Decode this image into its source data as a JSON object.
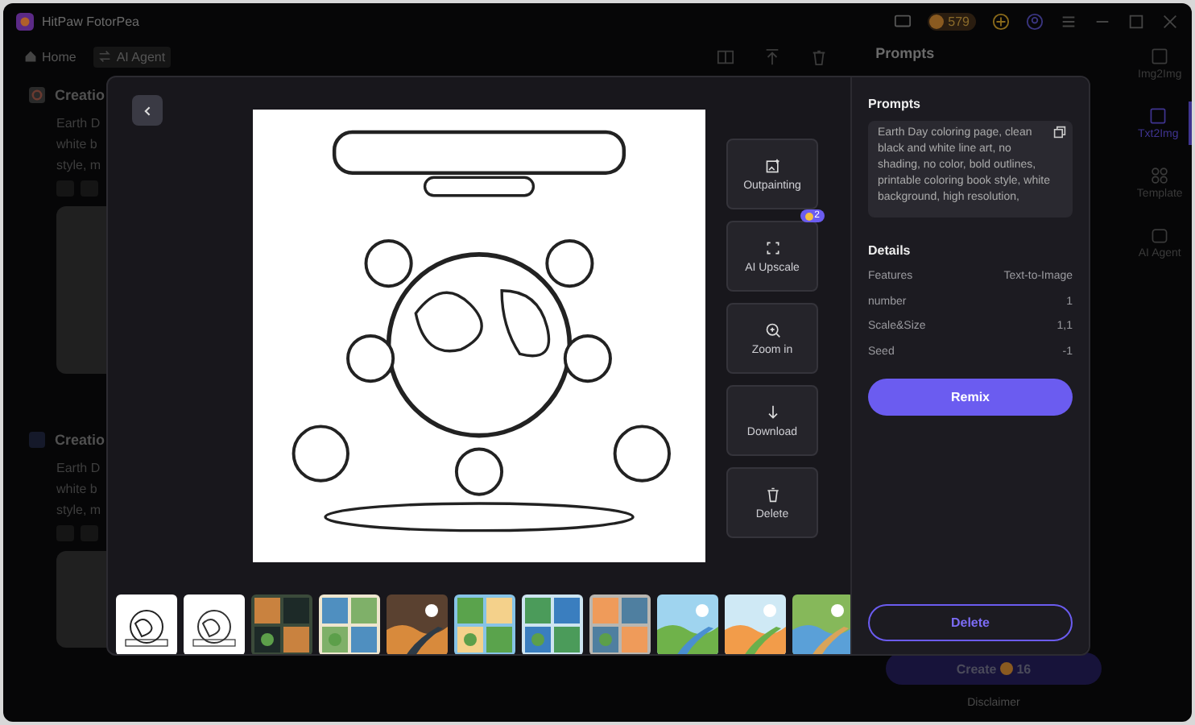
{
  "window": {
    "title": "HitPaw FotorPea",
    "coins": "579"
  },
  "nav": [
    {
      "label": "Home",
      "kind": "home"
    },
    {
      "label": "AI Agent",
      "kind": "agent"
    }
  ],
  "feed": [
    {
      "title": "Creatio",
      "lines": [
        "Earth D",
        "white b",
        "style, m"
      ],
      "kind": "google"
    },
    {
      "title": "Creatio",
      "lines": [
        "Earth D",
        "white b",
        "style, m"
      ],
      "kind": "other"
    }
  ],
  "side_panel": {
    "title": "Prompts",
    "create": {
      "label": "Create",
      "cost": "16"
    },
    "disclaimer": "Disclaimer"
  },
  "sidebar": {
    "items": [
      {
        "label": "Img2Img",
        "kind": "img",
        "selected": false
      },
      {
        "label": "Txt2Img",
        "kind": "txt",
        "selected": true
      },
      {
        "label": "Template",
        "kind": "template",
        "selected": false
      },
      {
        "label": "AI Agent",
        "kind": "agent",
        "selected": false
      }
    ]
  },
  "viewer": {
    "tools": [
      {
        "label": "Outpainting",
        "kind": "outpaint"
      },
      {
        "label": "AI Upscale",
        "kind": "upscale",
        "badge": "2"
      },
      {
        "label": "Zoom in",
        "kind": "zoom"
      },
      {
        "label": "Download",
        "kind": "download"
      },
      {
        "label": "Delete",
        "kind": "delete"
      }
    ],
    "prompts": {
      "title": "Prompts",
      "text": "Earth Day coloring page, clean black and white line art, no shading, no color, bold outlines, printable coloring book style, white background, high resolution,"
    },
    "details": {
      "title": "Details",
      "rows": [
        {
          "label": "Features",
          "value": "Text-to-Image"
        },
        {
          "label": "number",
          "value": "1"
        },
        {
          "label": "Scale&Size",
          "value": "1,1"
        },
        {
          "label": "Seed",
          "value": "-1"
        }
      ]
    },
    "remix": "Remix",
    "delete": "Delete"
  }
}
